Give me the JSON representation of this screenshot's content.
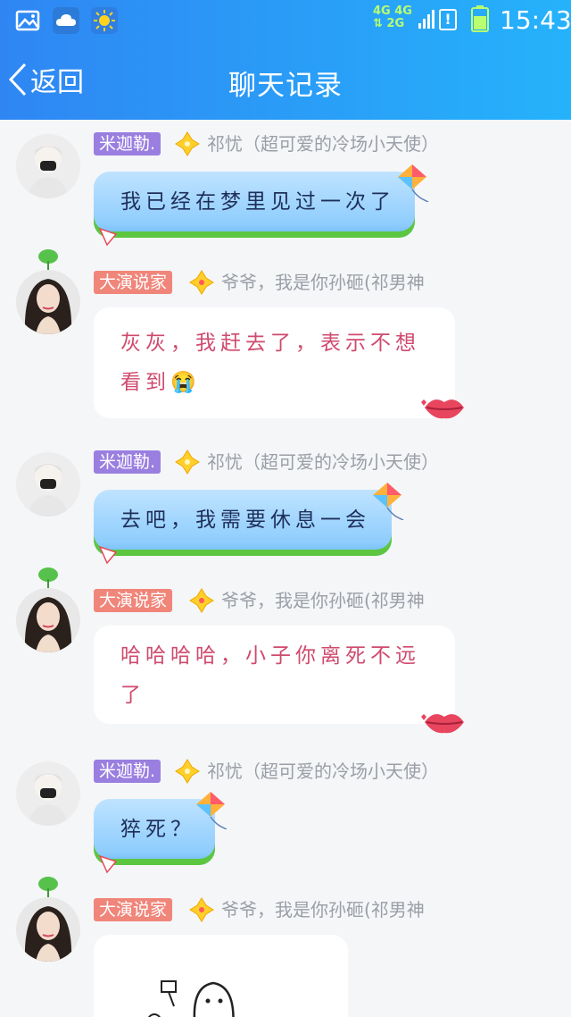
{
  "status_bar": {
    "network": [
      "4G 4G",
      "⇅ 2G"
    ],
    "time": "15:43"
  },
  "nav": {
    "back_label": "返回",
    "title": "聊天记录"
  },
  "messages": [
    {
      "sender_tag": "米迦勒.",
      "sender_name": "祁忧（超可爱的冷场小天使）",
      "text": "我已经在梦里见过一次了"
    },
    {
      "sender_tag": "大演说家",
      "sender_name": "爷爷，我是你孙砸(祁男神",
      "text": "灰灰，我赶去了，表示不想看到😭"
    },
    {
      "sender_tag": "米迦勒.",
      "sender_name": "祁忧（超可爱的冷场小天使）",
      "text": "去吧，我需要休息一会"
    },
    {
      "sender_tag": "大演说家",
      "sender_name": "爷爷，我是你孙砸(祁男神",
      "text": "哈哈哈哈，小子你离死不远了"
    },
    {
      "sender_tag": "米迦勒.",
      "sender_name": "祁忧（超可爱的冷场小天使）",
      "text": "猝死？"
    },
    {
      "sender_tag": "大演说家",
      "sender_name": "爷爷，我是你孙砸(祁男神",
      "text": ""
    }
  ],
  "colors": {
    "header_gradient": [
      "#2f86f3",
      "#25b2fb"
    ],
    "tag_purple": "#9a7fe0",
    "tag_pink": "#f0857a",
    "pink_text": "#cf4a6e"
  }
}
